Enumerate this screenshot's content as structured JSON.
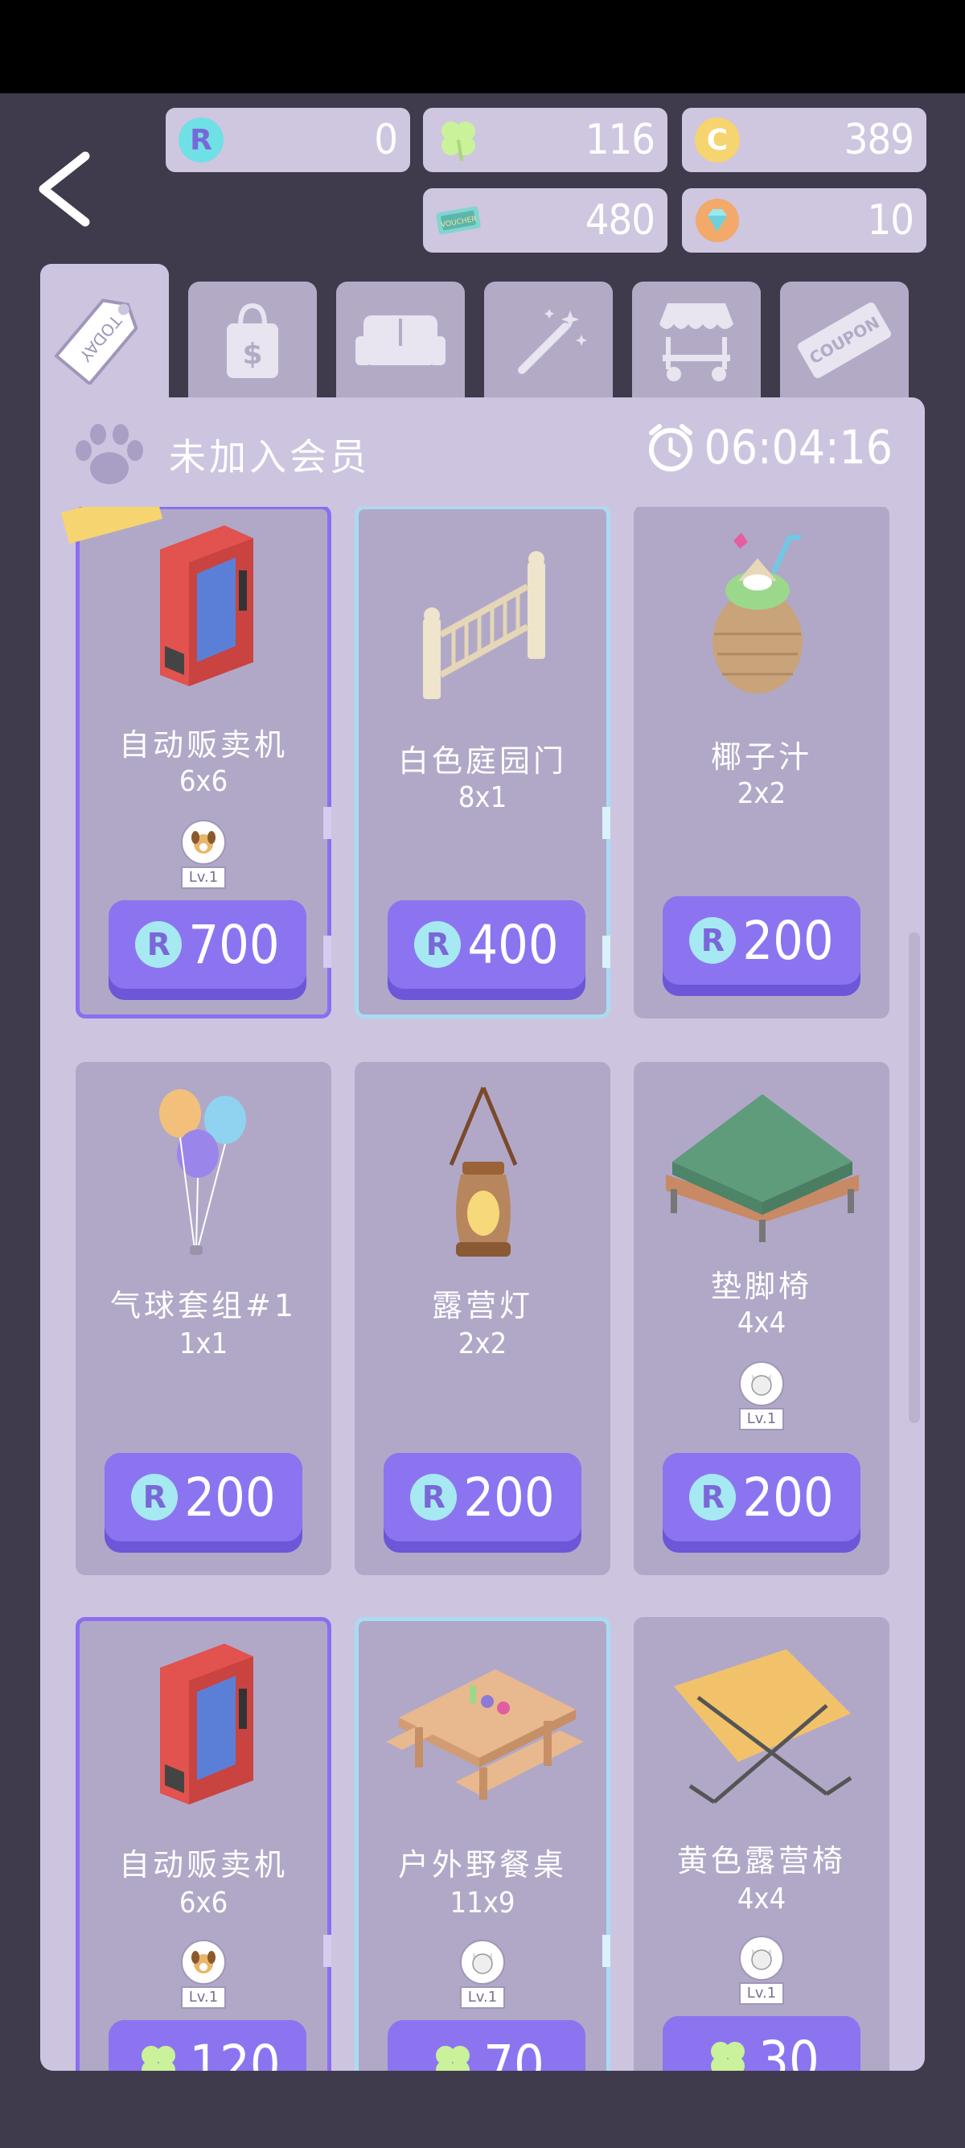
{
  "currencies": {
    "r_coin": "0",
    "clover": "116",
    "c_coin": "389",
    "voucher": "480",
    "diamond": "10"
  },
  "icons": {
    "r_coin_letter": "R",
    "c_coin_letter": "C",
    "voucher_text": "VOUCHER",
    "tab_today": "TODAY",
    "tab_coupon": "COUPON",
    "tab_dollar": "$"
  },
  "header": {
    "membership": "未加入会员",
    "timer": "06:04:16"
  },
  "level_label": "Lv.1",
  "items": [
    {
      "name": "自动贩卖机",
      "size": "6x6",
      "price": "700",
      "currency": "R"
    },
    {
      "name": "白色庭园门",
      "size": "8x1",
      "price": "400",
      "currency": "R"
    },
    {
      "name": "椰子汁",
      "size": "2x2",
      "price": "200",
      "currency": "R"
    },
    {
      "name": "气球套组#1",
      "size": "1x1",
      "price": "200",
      "currency": "R"
    },
    {
      "name": "露营灯",
      "size": "2x2",
      "price": "200",
      "currency": "R"
    },
    {
      "name": "垫脚椅",
      "size": "4x4",
      "price": "200",
      "currency": "R"
    },
    {
      "name": "自动贩卖机",
      "size": "6x6",
      "price": "120",
      "currency": "clover"
    },
    {
      "name": "户外野餐桌",
      "size": "11x9",
      "price": "70",
      "currency": "clover"
    },
    {
      "name": "黄色露营椅",
      "size": "4x4",
      "price": "30",
      "currency": "clover"
    }
  ],
  "colors": {
    "accent": "#8c74f0",
    "panel": "#cdc5e0",
    "card": "#b1a8c8",
    "highlight_purple": "#8c6ef0",
    "highlight_blue": "#a9dcf3"
  }
}
